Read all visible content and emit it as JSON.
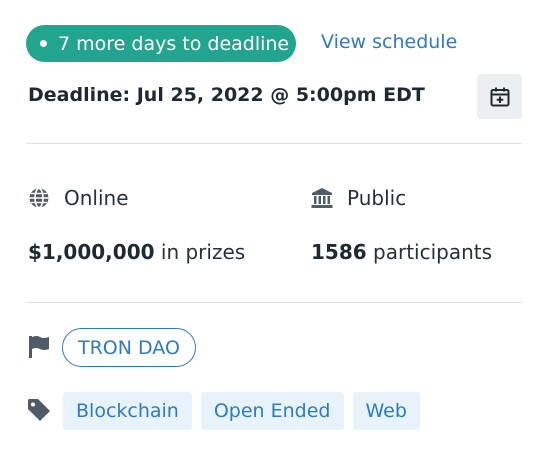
{
  "countdown": {
    "label": "7 more days to deadline"
  },
  "schedule_link": {
    "label": "View schedule"
  },
  "deadline": {
    "text": "Deadline: Jul 25, 2022 @ 5:00pm EDT"
  },
  "calendar_button": {
    "icon": "calendar-plus-icon"
  },
  "location": {
    "icon": "globe-icon",
    "label": "Online"
  },
  "visibility": {
    "icon": "bank-icon",
    "label": "Public"
  },
  "prizes": {
    "amount": "$1,000,000",
    "suffix": " in prizes"
  },
  "participants": {
    "count": "1586",
    "suffix": " participants"
  },
  "host": {
    "icon": "flag-icon",
    "name": "TRON DAO"
  },
  "themes": {
    "icon": "tag-icon",
    "items": [
      {
        "label": "Blockchain"
      },
      {
        "label": "Open Ended"
      },
      {
        "label": "Web"
      }
    ]
  },
  "colors": {
    "accent_green": "#21a58f",
    "link_blue": "#2f7bbf",
    "tag_bg": "#e7f2fb",
    "icon_gray": "#4f5b66"
  }
}
